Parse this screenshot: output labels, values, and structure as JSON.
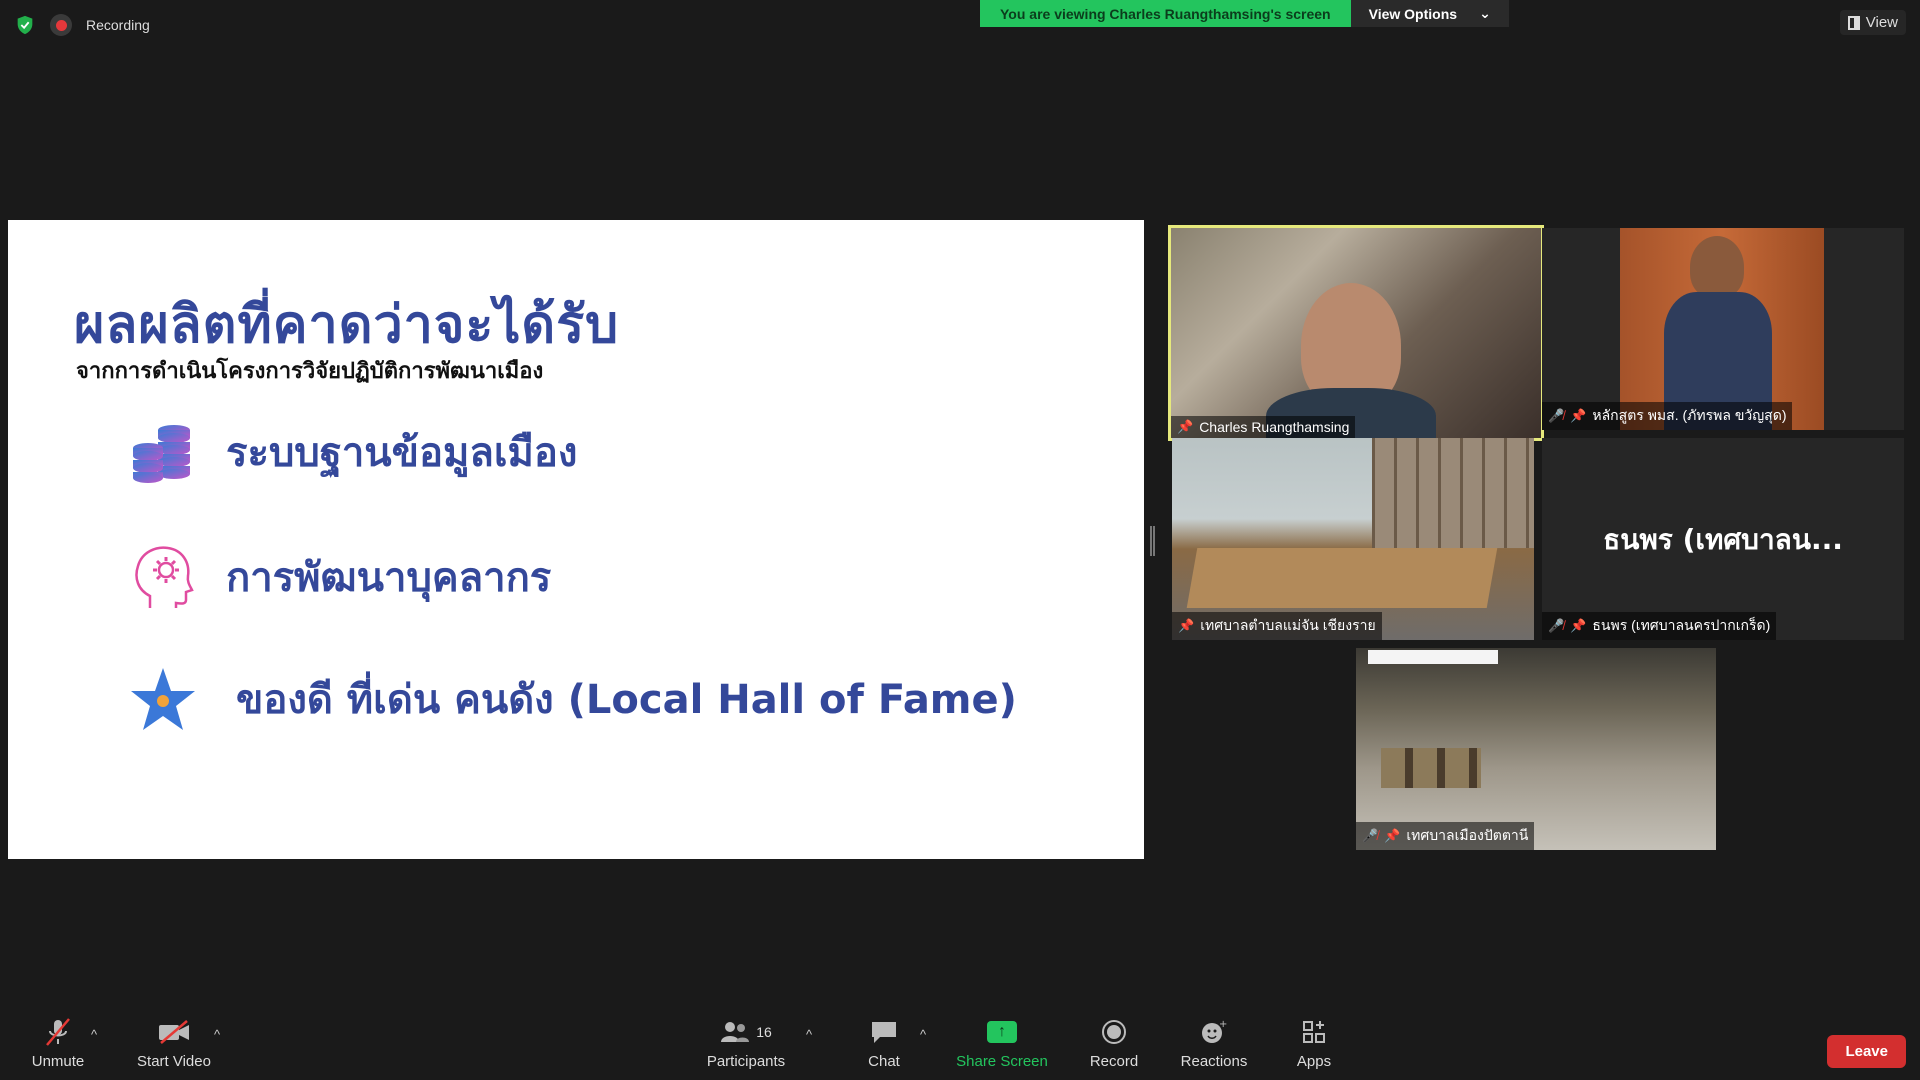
{
  "topbar": {
    "recording_label": "Recording",
    "viewing_banner": "You are viewing Charles Ruangthamsing's screen",
    "view_options_label": "View Options",
    "view_label": "View"
  },
  "slide": {
    "title": "ผลผลิตที่คาดว่าจะได้รับ",
    "subtitle": "จากการดำเนินโครงการวิจัยปฏิบัติการพัฒนาเมือง",
    "items": [
      {
        "text": "ระบบฐานข้อมูลเมือง",
        "icon": "database-icon"
      },
      {
        "text": "การพัฒนาบุคลากร",
        "icon": "head-gear-icon"
      },
      {
        "text": "ของดี ที่เด่น คนดัง (Local Hall of Fame)",
        "icon": "star-icon"
      }
    ]
  },
  "participants_tiles": [
    {
      "name": "Charles Ruangthamsing",
      "muted": false,
      "active_speaker": true
    },
    {
      "name": "หลักสูตร พมส. (ภัทรพล ขวัญสุด)",
      "muted": true
    },
    {
      "name": "เทศบาลตำบลแม่จัน เชียงราย",
      "muted": false
    },
    {
      "name": "ธนพร (เทศบาลนครปากเกร็ด)",
      "display_text": "ธนพร (เทศบาลน...",
      "muted": true
    },
    {
      "name": "เทศบาลเมืองปัตตานี",
      "muted": true
    }
  ],
  "toolbar": {
    "unmute_label": "Unmute",
    "start_video_label": "Start Video",
    "participants_label": "Participants",
    "participants_count": "16",
    "chat_label": "Chat",
    "share_screen_label": "Share Screen",
    "record_label": "Record",
    "reactions_label": "Reactions",
    "apps_label": "Apps",
    "leave_label": "Leave"
  },
  "colors": {
    "banner_green": "#23c55e",
    "slide_title": "#34489a",
    "active_border": "#e6e97c",
    "leave_red": "#d32f2f"
  }
}
